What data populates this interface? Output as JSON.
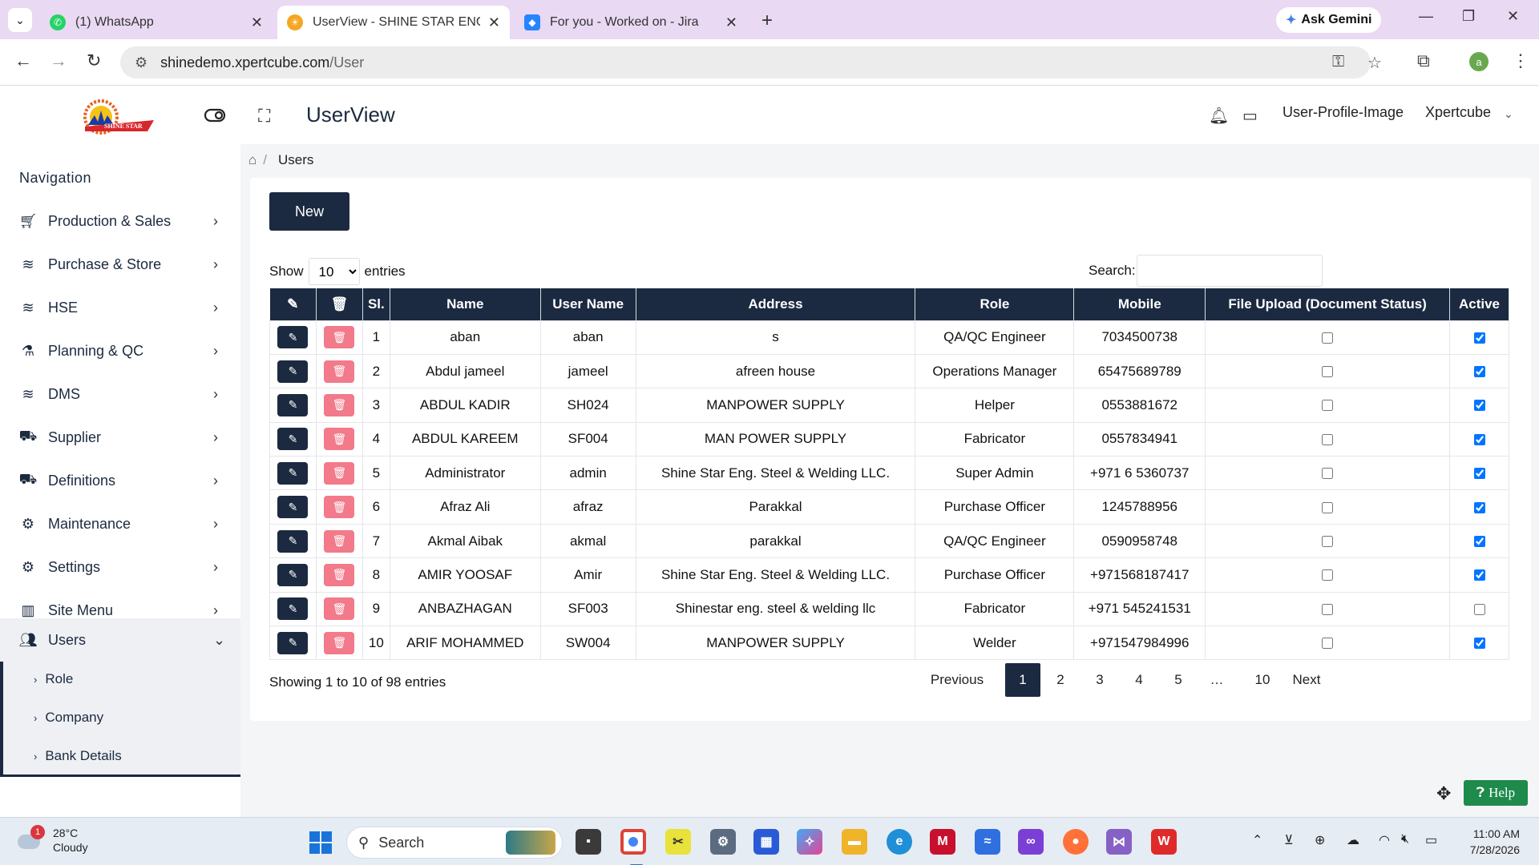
{
  "browser": {
    "tabs": [
      {
        "title": "(1) WhatsApp",
        "icon": "whatsapp-icon",
        "color": "#25d366",
        "active": false
      },
      {
        "title": "UserView - SHINE STAR ENG ST",
        "icon": "shine-star-favicon",
        "color": "#f5a623",
        "active": true
      },
      {
        "title": "For you - Worked on - Jira",
        "icon": "jira-icon",
        "color": "#2684ff",
        "active": false
      }
    ],
    "gemini_label": "Ask Gemini",
    "url_domain": "shinedemo.xpertcube.com",
    "url_path": "/User",
    "profile_letter": "a"
  },
  "header": {
    "logo_text": "SHINE STAR",
    "page_title": "UserView",
    "profile_image_alt": "User-Profile-Image",
    "user_name": "Xpertcube"
  },
  "sidebar": {
    "heading": "Navigation",
    "items": [
      {
        "label": "Production & Sales",
        "icon": "cart-icon"
      },
      {
        "label": "Purchase & Store",
        "icon": "database-icon"
      },
      {
        "label": "HSE",
        "icon": "database-icon"
      },
      {
        "label": "Planning & QC",
        "icon": "flask-icon"
      },
      {
        "label": "DMS",
        "icon": "database-icon"
      },
      {
        "label": "Supplier",
        "icon": "truck-icon"
      },
      {
        "label": "Definitions",
        "icon": "truck-icon"
      },
      {
        "label": "Maintenance",
        "icon": "gears-icon"
      },
      {
        "label": "Settings",
        "icon": "gears-icon"
      },
      {
        "label": "Site Menu",
        "icon": "bar-chart-icon"
      },
      {
        "label": "Users",
        "icon": "users-icon"
      }
    ],
    "subitems": [
      "Role",
      "Company",
      "Bank Details"
    ]
  },
  "breadcrumb": {
    "current": "Users"
  },
  "toolbar": {
    "new_label": "New"
  },
  "table_controls": {
    "show_label": "Show",
    "page_length": "10",
    "entries_label": "entries",
    "search_label": "Search:",
    "search_value": ""
  },
  "table": {
    "columns": [
      "Sl.",
      "Name",
      "User Name",
      "Address",
      "Role",
      "Mobile",
      "File Upload (Document Status)",
      "Active"
    ],
    "rows": [
      {
        "sl": "1",
        "name": "aban",
        "username": "aban",
        "address": "s",
        "role": "QA/QC Engineer",
        "mobile": "7034500738",
        "file_upload": false,
        "active": true
      },
      {
        "sl": "2",
        "name": "Abdul jameel",
        "username": "jameel",
        "address": "afreen house",
        "role": "Operations Manager",
        "mobile": "65475689789",
        "file_upload": false,
        "active": true
      },
      {
        "sl": "3",
        "name": "ABDUL KADIR",
        "username": "SH024",
        "address": "MANPOWER SUPPLY",
        "role": "Helper",
        "mobile": "0553881672",
        "file_upload": false,
        "active": true
      },
      {
        "sl": "4",
        "name": "ABDUL KAREEM",
        "username": "SF004",
        "address": "MAN POWER SUPPLY",
        "role": "Fabricator",
        "mobile": "0557834941",
        "file_upload": false,
        "active": true
      },
      {
        "sl": "5",
        "name": "Administrator",
        "username": "admin",
        "address": "Shine Star Eng. Steel & Welding LLC.",
        "role": "Super Admin",
        "mobile": "+971 6 5360737",
        "file_upload": false,
        "active": true
      },
      {
        "sl": "6",
        "name": "Afraz Ali",
        "username": "afraz",
        "address": "Parakkal",
        "role": "Purchase Officer",
        "mobile": "1245788956",
        "file_upload": false,
        "active": true
      },
      {
        "sl": "7",
        "name": "Akmal Aibak",
        "username": "akmal",
        "address": "parakkal",
        "role": "QA/QC Engineer",
        "mobile": "0590958748",
        "file_upload": false,
        "active": true
      },
      {
        "sl": "8",
        "name": "AMIR YOOSAF",
        "username": "Amir",
        "address": "Shine Star Eng. Steel & Welding LLC.",
        "role": "Purchase Officer",
        "mobile": "+971568187417",
        "file_upload": false,
        "active": true
      },
      {
        "sl": "9",
        "name": "ANBAZHAGAN",
        "username": "SF003",
        "address": "Shinestar eng. steel & welding llc",
        "role": "Fabricator",
        "mobile": "+971 545241531",
        "file_upload": false,
        "active": false
      },
      {
        "sl": "10",
        "name": "ARIF MOHAMMED",
        "username": "SW004",
        "address": "MANPOWER SUPPLY",
        "role": "Welder",
        "mobile": "+971547984996",
        "file_upload": false,
        "active": true
      }
    ],
    "info": "Showing 1 to 10 of 98 entries"
  },
  "pagination": {
    "previous": "Previous",
    "pages": [
      "1",
      "2",
      "3",
      "4",
      "5",
      "…",
      "10"
    ],
    "current": "1",
    "next": "Next"
  },
  "help_label": "Help",
  "taskbar": {
    "weather_temp": "28°C",
    "weather_desc": "Cloudy",
    "weather_badge": "1",
    "search_placeholder": "Search",
    "time": "11:00 AM",
    "date": "7/28/2026"
  },
  "colors": {
    "primary_navy": "#1b2a40",
    "delete_pink": "#f27a8a",
    "help_green": "#1e8a4c",
    "tabbar_purple": "#e9d9f3"
  }
}
